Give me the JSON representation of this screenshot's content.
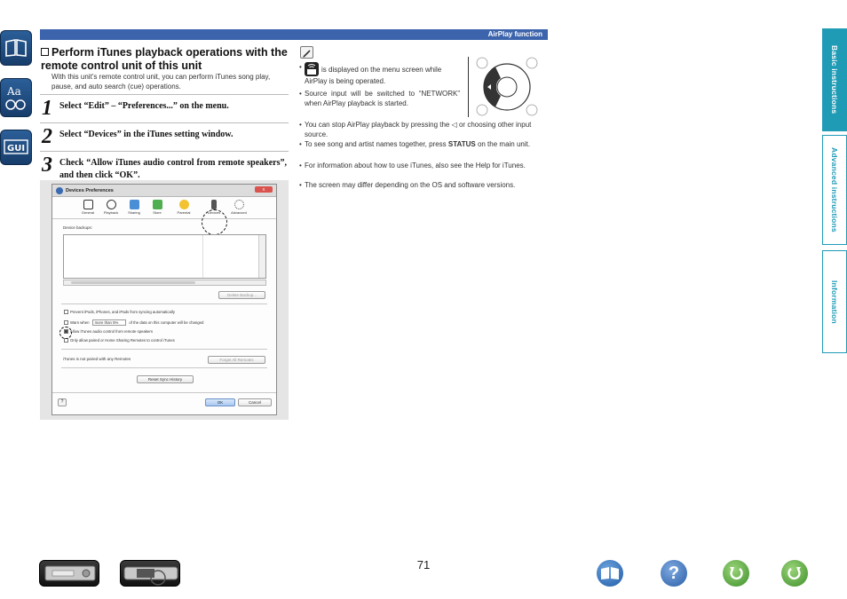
{
  "header": {
    "section_label": "AirPlay function"
  },
  "section": {
    "title": "Perform iTunes playback operations with the remote control unit of this unit",
    "description": "With this unit’s remote control unit, you can perform iTunes song play, pause, and auto search (cue) operations."
  },
  "steps": [
    {
      "number": "1",
      "text": "Select “Edit” – “Preferences...” on the menu."
    },
    {
      "number": "2",
      "text": "Select “Devices” in the iTunes setting window."
    },
    {
      "number": "3",
      "text": "Check “Allow iTunes audio control from remote speakers”, and then click “OK”."
    }
  ],
  "dialog": {
    "title": "Devices Preferences",
    "close_label": "X",
    "toolbar": [
      "General",
      "Playback",
      "Sharing",
      "Store",
      "Parental",
      "Devices",
      "Advanced"
    ],
    "backups_label": "Device backups:",
    "delete_backup": "Delete Backup...",
    "options": {
      "prevent_sync": "Prevent iPods, iPhones, and iPads from syncing automatically",
      "warn_prefix": "Warn when",
      "warn_select": "more than 5%",
      "warn_suffix": "of the data on this computer will be changed",
      "allow_audio": "Allow iTunes audio control from remote speakers",
      "only_paired": "Only allow paired or Home Sharing Remotes to control iTunes"
    },
    "paired_text": "iTunes is not paired with any Remotes",
    "forget_remotes": "Forget All Remotes",
    "reset_sync": "Reset Sync History",
    "help": "?",
    "ok": "OK",
    "cancel": "Cancel"
  },
  "notes": {
    "menu_shown": "is displayed on the menu screen while AirPlay is being operated.",
    "source_network": "Source input will be switched to “NETWORK” when AirPlay playback is started.",
    "stop_part1": "You can stop AirPlay playback by pressing the",
    "stop_symbol": "◁",
    "stop_part2": "or choosing other input source.",
    "status_part1": "To see song and artist names together, press",
    "status_word": "STATUS",
    "status_part2": "on the main unit.",
    "itunes_help": "For information about how to use iTunes, also see the Help for iTunes.",
    "screen_differ": "The screen may differ depending on the OS and software versions."
  },
  "side_tabs": [
    "Basic instructions",
    "Advanced instructions",
    "Information"
  ],
  "page_number": "71",
  "colors": {
    "accent_blue": "#3c64ac",
    "tab_teal": "#1f9bb6"
  }
}
